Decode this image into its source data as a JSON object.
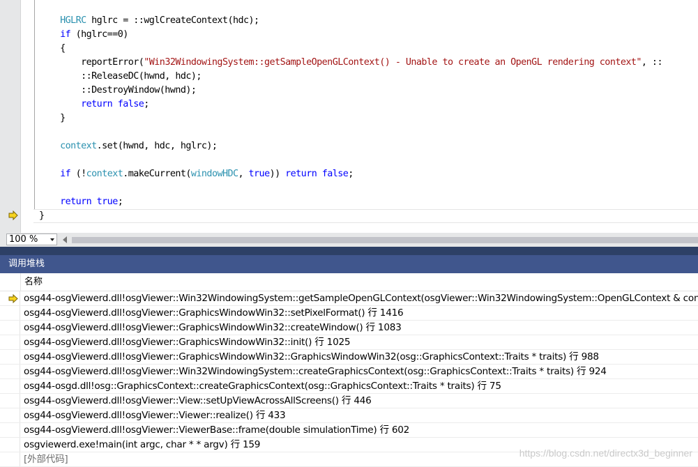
{
  "colors": {
    "keyword": "#0000ff",
    "type": "#2b91af",
    "string": "#a31515",
    "panel_title_bg": "#40568d",
    "splitter": "#2d4066",
    "exec_arrow_fill": "#f7d31f",
    "exec_arrow_stroke": "#7a6300"
  },
  "editor": {
    "lines": [
      {
        "indent": "    ",
        "tokens": [
          {
            "t": "type",
            "v": "HGLRC"
          },
          {
            "t": "plain",
            "v": " hglrc = ::wglCreateContext(hdc);"
          }
        ]
      },
      {
        "indent": "    ",
        "tokens": [
          {
            "t": "kw",
            "v": "if"
          },
          {
            "t": "plain",
            "v": " (hglrc==0)"
          }
        ]
      },
      {
        "indent": "    ",
        "tokens": [
          {
            "t": "plain",
            "v": "{"
          }
        ]
      },
      {
        "indent": "        ",
        "tokens": [
          {
            "t": "plain",
            "v": "reportError("
          },
          {
            "t": "str",
            "v": "\"Win32WindowingSystem::getSampleOpenGLContext() - Unable to create an OpenGL rendering context\""
          },
          {
            "t": "plain",
            "v": ", ::"
          }
        ]
      },
      {
        "indent": "        ",
        "tokens": [
          {
            "t": "plain",
            "v": "::ReleaseDC(hwnd, hdc);"
          }
        ]
      },
      {
        "indent": "        ",
        "tokens": [
          {
            "t": "plain",
            "v": "::DestroyWindow(hwnd);"
          }
        ]
      },
      {
        "indent": "        ",
        "tokens": [
          {
            "t": "kw",
            "v": "return"
          },
          {
            "t": "plain",
            "v": " "
          },
          {
            "t": "kw",
            "v": "false"
          },
          {
            "t": "plain",
            "v": ";"
          }
        ]
      },
      {
        "indent": "    ",
        "tokens": [
          {
            "t": "plain",
            "v": "}"
          }
        ]
      },
      {
        "indent": "",
        "tokens": []
      },
      {
        "indent": "    ",
        "tokens": [
          {
            "t": "type",
            "v": "context"
          },
          {
            "t": "plain",
            "v": ".set(hwnd, hdc, hglrc);"
          }
        ]
      },
      {
        "indent": "",
        "tokens": []
      },
      {
        "indent": "    ",
        "tokens": [
          {
            "t": "kw",
            "v": "if"
          },
          {
            "t": "plain",
            "v": " (!"
          },
          {
            "t": "type",
            "v": "context"
          },
          {
            "t": "plain",
            "v": ".makeCurrent("
          },
          {
            "t": "type",
            "v": "windowHDC"
          },
          {
            "t": "plain",
            "v": ", "
          },
          {
            "t": "kw",
            "v": "true"
          },
          {
            "t": "plain",
            "v": ")) "
          },
          {
            "t": "kw",
            "v": "return"
          },
          {
            "t": "plain",
            "v": " "
          },
          {
            "t": "kw",
            "v": "false"
          },
          {
            "t": "plain",
            "v": ";"
          }
        ]
      },
      {
        "indent": "",
        "tokens": []
      },
      {
        "indent": "    ",
        "tokens": [
          {
            "t": "kw",
            "v": "return"
          },
          {
            "t": "plain",
            "v": " "
          },
          {
            "t": "kw",
            "v": "true"
          },
          {
            "t": "plain",
            "v": ";"
          }
        ]
      },
      {
        "indent": "",
        "tokens": [
          {
            "t": "plain",
            "v": "}"
          }
        ],
        "current": true
      }
    ]
  },
  "zoom": {
    "value": "100 %"
  },
  "callstack": {
    "title": "调用堆栈",
    "column_name": "名称",
    "rows": [
      {
        "text": "osg44-osgViewerd.dll!osgViewer::Win32WindowingSystem::getSampleOpenGLContext(osgViewer::Win32WindowingSystem::OpenGLContext & context, HDC_ * hdc",
        "current": true
      },
      {
        "text": "osg44-osgViewerd.dll!osgViewer::GraphicsWindowWin32::setPixelFormat() 行 1416"
      },
      {
        "text": "osg44-osgViewerd.dll!osgViewer::GraphicsWindowWin32::createWindow() 行 1083"
      },
      {
        "text": "osg44-osgViewerd.dll!osgViewer::GraphicsWindowWin32::init() 行 1025"
      },
      {
        "text": "osg44-osgViewerd.dll!osgViewer::GraphicsWindowWin32::GraphicsWindowWin32(osg::GraphicsContext::Traits * traits) 行 988"
      },
      {
        "text": "osg44-osgViewerd.dll!osgViewer::Win32WindowingSystem::createGraphicsContext(osg::GraphicsContext::Traits * traits) 行 924"
      },
      {
        "text": "osg44-osgd.dll!osg::GraphicsContext::createGraphicsContext(osg::GraphicsContext::Traits * traits) 行 75"
      },
      {
        "text": "osg44-osgViewerd.dll!osgViewer::View::setUpViewAcrossAllScreens() 行 446"
      },
      {
        "text": "osg44-osgViewerd.dll!osgViewer::Viewer::realize() 行 433"
      },
      {
        "text": "osg44-osgViewerd.dll!osgViewer::ViewerBase::frame(double simulationTime) 行 602"
      },
      {
        "text": "osgviewerd.exe!main(int argc, char * * argv) 行 159"
      },
      {
        "text": "[外部代码]",
        "external": true
      }
    ]
  },
  "watermark": "https://blog.csdn.net/directx3d_beginner"
}
